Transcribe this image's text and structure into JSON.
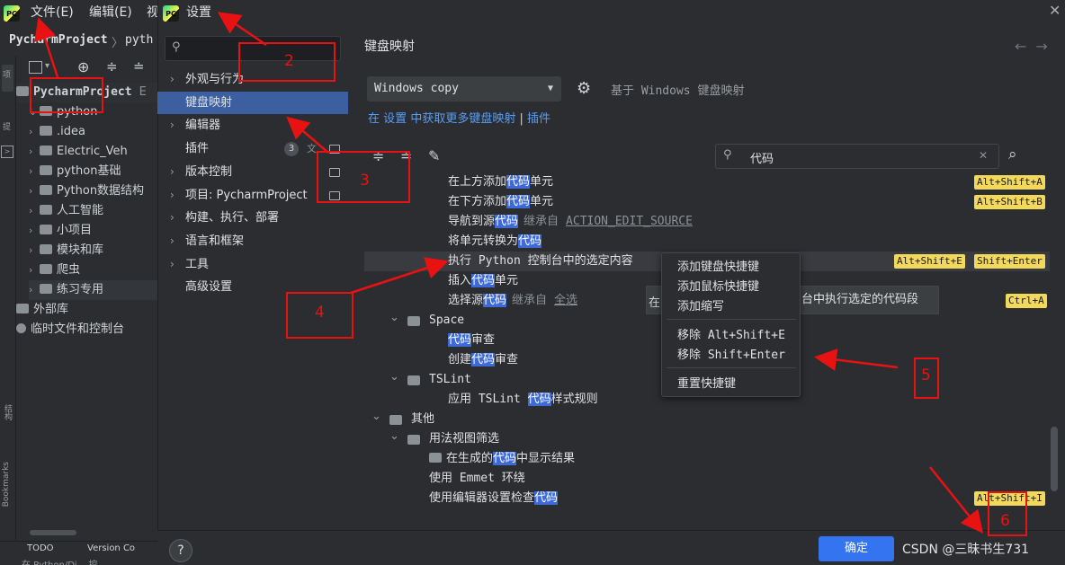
{
  "ide": {
    "menu": {
      "file": "文件(E)",
      "edit": "编辑(E)",
      "view_partial": "视"
    },
    "breadcrumb": {
      "project": "PycharmProject",
      "sep": "〉",
      "folder": "pyth"
    },
    "side_strip_label_top": "项",
    "side_strip_label_mid": "提",
    "side_strip_label_struct": "结构",
    "side_strip_label_bookmarks": "Bookmarks",
    "tree": [
      {
        "label": "PycharmProject",
        "suffix": "E",
        "level": 0,
        "kind": "root"
      },
      {
        "label": "python",
        "level": 1,
        "kind": "folder"
      },
      {
        "label": ".idea",
        "level": 2,
        "kind": "folder"
      },
      {
        "label": "Electric_Veh",
        "level": 2,
        "kind": "folder"
      },
      {
        "label": "python基础",
        "level": 2,
        "kind": "folder"
      },
      {
        "label": "Python数据结构",
        "level": 2,
        "kind": "folder"
      },
      {
        "label": "人工智能",
        "level": 2,
        "kind": "folder"
      },
      {
        "label": "小项目",
        "level": 2,
        "kind": "folder"
      },
      {
        "label": "模块和库",
        "level": 2,
        "kind": "folder"
      },
      {
        "label": "爬虫",
        "level": 2,
        "kind": "folder"
      },
      {
        "label": "练习专用",
        "level": 2,
        "kind": "folder"
      },
      {
        "label": "外部库",
        "level": 0,
        "kind": "lib"
      },
      {
        "label": "临时文件和控制台",
        "level": 0,
        "kind": "scratch"
      }
    ],
    "bottom_tabs": {
      "todo": "TODO",
      "vc": "Version Co"
    },
    "status_partial": "在 Python/Di... 控"
  },
  "dialog": {
    "title": "设置",
    "close": "✕",
    "search_placeholder": "",
    "nav": [
      {
        "label": "外观与行为",
        "arrow": true
      },
      {
        "label": "键盘映射",
        "arrow": false,
        "selected": true
      },
      {
        "label": "编辑器",
        "arrow": true
      },
      {
        "label": "插件",
        "arrow": false,
        "badge": "3"
      },
      {
        "label": "版本控制",
        "arrow": true
      },
      {
        "label": "项目: PycharmProject",
        "arrow": true
      },
      {
        "label": "构建、执行、部署",
        "arrow": true
      },
      {
        "label": "语言和框架",
        "arrow": true
      },
      {
        "label": "工具",
        "arrow": true
      },
      {
        "label": "高级设置",
        "arrow": false
      }
    ],
    "panel": {
      "title": "键盘映射",
      "back_arrow": "←",
      "forward_arrow": "→",
      "keymap_value": "Windows copy",
      "based_on": "基于 Windows 键盘映射",
      "links": {
        "pre": "在",
        "settings": "设置",
        "mid": "中获取更多键盘映射",
        "sep": "|",
        "plugins": "插件"
      },
      "search_value": "代码",
      "rows": [
        {
          "pre": "在上方添加",
          "hit": "代码",
          "post": "单元",
          "shortcuts": [
            "Alt+Shift+A"
          ]
        },
        {
          "pre": "在下方添加",
          "hit": "代码",
          "post": "单元",
          "shortcuts": [
            "Alt+Shift+B"
          ]
        },
        {
          "pre": "导航到源",
          "hit": "代码",
          "post": "",
          "inherit": "继承自",
          "link": "ACTION_EDIT_SOURCE",
          "shortcuts": []
        },
        {
          "pre": "将单元转换为",
          "hit": "代码",
          "post": "",
          "shortcuts": []
        },
        {
          "pre": "执行 Python 控制台中的选定内容",
          "hit": "",
          "post": "",
          "shortcuts": [
            "Alt+Shift+E",
            "Shift+Enter"
          ],
          "highlighted": true
        },
        {
          "pre": "插入",
          "hit": "代码",
          "post": "单元",
          "shortcuts": []
        },
        {
          "pre": "选择源",
          "hit": "代码",
          "post": "",
          "inherit": "继承自",
          "link": "全选",
          "shortcuts": [
            "Ctrl+A"
          ]
        },
        {
          "group": "Space"
        },
        {
          "pre": "",
          "hit": "代码",
          "post": "审查",
          "shortcuts": []
        },
        {
          "pre": "创建",
          "hit": "代码",
          "post": "审查",
          "shortcuts": []
        },
        {
          "group": "TSLint"
        },
        {
          "pre": "应用 TSLint ",
          "hit": "代码",
          "post": "样式规则",
          "shortcuts": []
        },
        {
          "group": "其他"
        },
        {
          "group": "用法视图筛选"
        },
        {
          "pre": "在生成的",
          "hit": "代码",
          "post": "中显示结果",
          "shortcuts": []
        },
        {
          "pre": "使用 Emmet 环绕",
          "hit": "",
          "post": "",
          "shortcuts": []
        },
        {
          "pre": "使用编辑器设置检查",
          "hit": "代码",
          "post": "",
          "shortcuts": [
            "Alt+Shift+I"
          ]
        }
      ],
      "tooltip_right": "台中执行选定的代码段",
      "tooltip_left": "在"
    },
    "context_menu": {
      "items": [
        "添加键盘快捷键",
        "添加鼠标快捷键",
        "添加缩写",
        "移除 Alt+Shift+E",
        "移除 Shift+Enter",
        "重置快捷键"
      ]
    },
    "help": "?",
    "ok": "确定",
    "watermark": "CSDN @三昧书生731"
  },
  "annotations": {
    "labels": [
      "2",
      "3",
      "4",
      "5",
      "6"
    ],
    "color": "#e81212"
  },
  "colors": {
    "accent": "#3574f0",
    "search_hit": "#3d6ad6",
    "shortcut_bg": "#f2d85b",
    "selected_nav": "#3c5fa0"
  }
}
